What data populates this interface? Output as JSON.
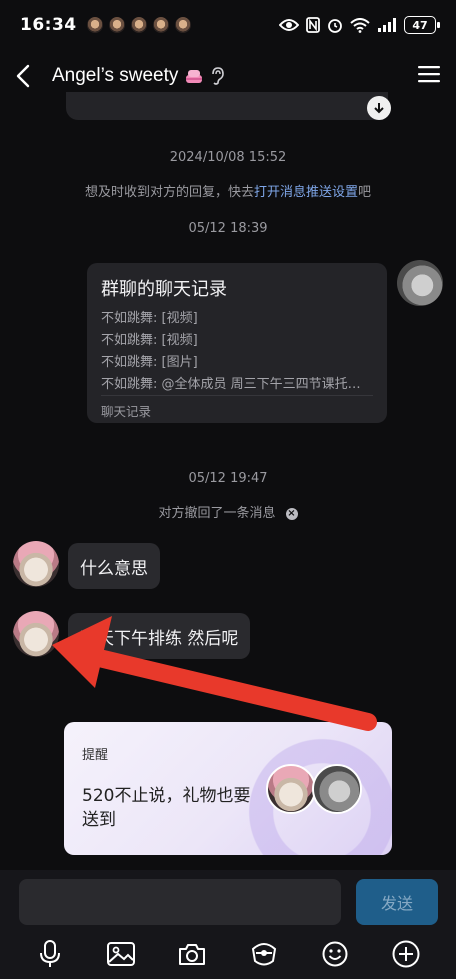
{
  "status_bar": {
    "time": "16:34",
    "battery": "47"
  },
  "header": {
    "title": "Angel’s sweety"
  },
  "timestamps": {
    "t1": "2024/10/08 15:52",
    "t2": "05/12 18:39",
    "t3": "05/12 19:47"
  },
  "notice": {
    "prefix": "想及时收到对方的回复，快去",
    "link": "打开消息推送设置",
    "suffix": "吧"
  },
  "chat_record": {
    "title": "群聊的聊天记录",
    "lines": [
      "不如跳舞: [视频]",
      "不如跳舞: [视频]",
      "不如跳舞: [图片]",
      "不如跳舞: @全体成员 周三下午三四节课托…"
    ],
    "footer": "聊天记录"
  },
  "recall_notice": "对方撤回了一条消息",
  "messages": [
    {
      "text": "什么意思"
    },
    {
      "text": "明天下午排练 然后呢"
    }
  ],
  "reminder": {
    "label": "提醒",
    "text": "520不止说，礼物也要送到"
  },
  "input": {
    "send_label": "发送"
  },
  "colors": {
    "background": "#0d0d0f",
    "bubble": "#2a2a2e",
    "link": "#7fa6e8",
    "send_button": "#1f5e8a",
    "arrow": "#e8392b"
  }
}
